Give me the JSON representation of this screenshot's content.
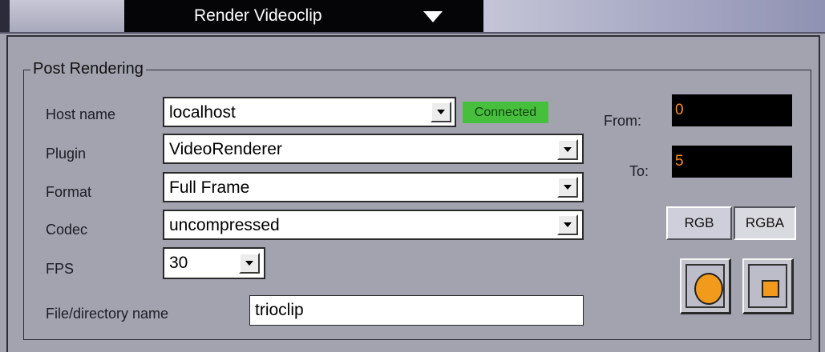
{
  "header": {
    "title": "Render Videoclip"
  },
  "group": {
    "title": "Post Rendering"
  },
  "form": {
    "host_name": {
      "label": "Host name",
      "value": "localhost",
      "status": "Connected"
    },
    "plugin": {
      "label": "Plugin",
      "value": "VideoRenderer"
    },
    "format": {
      "label": "Format",
      "value": "Full Frame"
    },
    "codec": {
      "label": "Codec",
      "value": "uncompressed"
    },
    "fps": {
      "label": "FPS",
      "value": "30"
    },
    "file": {
      "label": "File/directory name",
      "value": "trioclip"
    }
  },
  "range": {
    "from_label": "From:",
    "from_value": "0",
    "to_label": "To:",
    "to_value": "5"
  },
  "color_mode": {
    "rgb_label": "RGB",
    "rgba_label": "RGBA",
    "selected": "RGBA"
  },
  "buttons": {
    "record_icon": "record-icon",
    "stop_icon": "stop-icon"
  },
  "colors": {
    "status_green": "#46c03c",
    "field_text_orange": "#ff8c1a",
    "record_orange": "#f29a1c"
  }
}
